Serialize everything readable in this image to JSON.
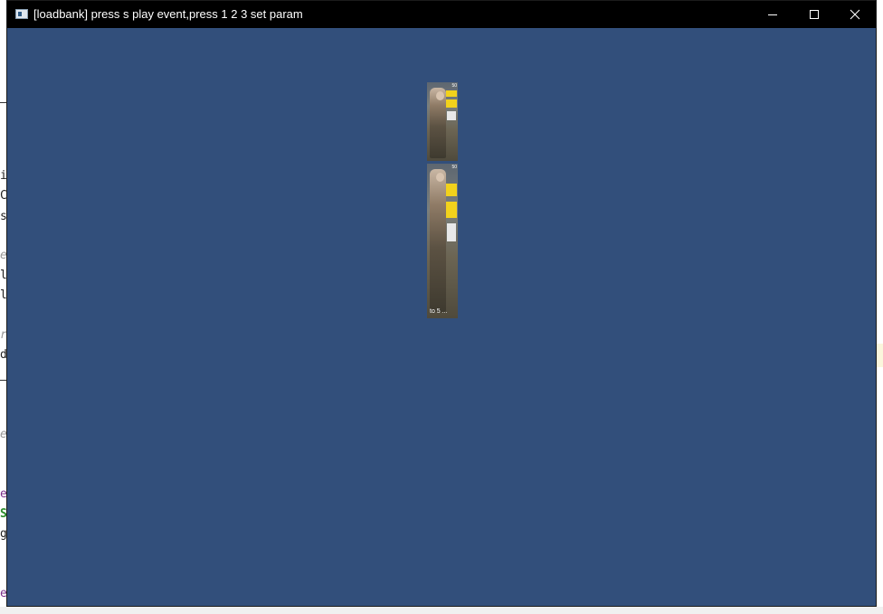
{
  "window": {
    "title": "[loadbank] press s play event,press 1 2 3 set param",
    "background_color": "#324f7b",
    "titlebar_color": "#000000",
    "controls": {
      "minimize_icon": "minimize-icon",
      "maximize_icon": "maximize-icon",
      "close_icon": "close-icon"
    }
  },
  "sprites": [
    {
      "name": "poster-sprite-small",
      "tag": "50",
      "caption": ""
    },
    {
      "name": "poster-sprite-large",
      "tag": "50",
      "caption": "to 5 ..."
    }
  ],
  "background_editor": {
    "visible_chars": [
      "i",
      "C",
      "s",
      "e",
      "l",
      "l",
      "r",
      "d",
      "e",
      "e",
      "S",
      "g",
      "e"
    ]
  }
}
